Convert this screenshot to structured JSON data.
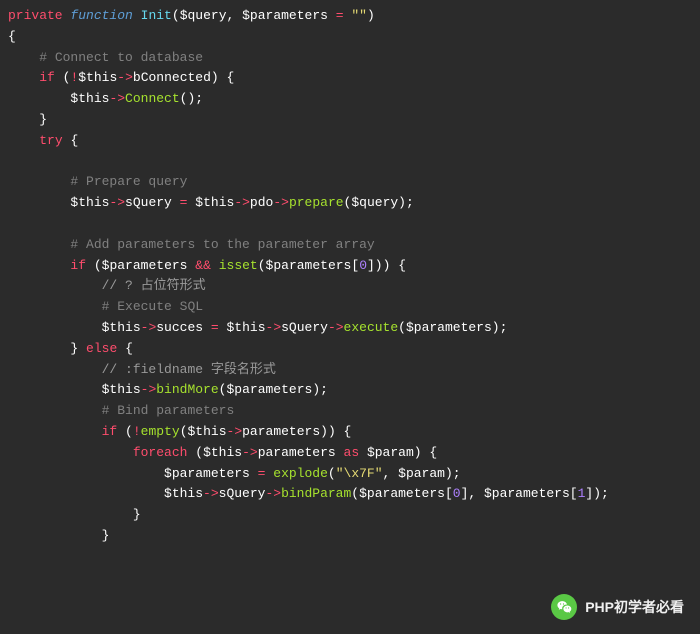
{
  "code": {
    "kw_private": "private",
    "kw_function": "function",
    "fn_init": "Init",
    "v_query": "$query",
    "v_parameters": "$parameters",
    "v_this": "$this",
    "v_param": "$param",
    "str_empty": "\"\"",
    "c_connect": "# Connect to database",
    "kw_if": "if",
    "p_bConnected": "bConnected",
    "fn_Connect": "Connect",
    "kw_try": "try",
    "c_prepare": "# Prepare query",
    "p_sQuery": "sQuery",
    "p_pdo": "pdo",
    "fn_prepare": "prepare",
    "c_addparams": "# Add parameters to the parameter array",
    "fn_isset": "isset",
    "num0": "0",
    "num1": "1",
    "c_placeholder": "// ? 占位符形式",
    "c_execsql": "# Execute SQL",
    "p_succes": "succes",
    "fn_execute": "execute",
    "kw_else": "else",
    "c_fieldname": "// :fieldname 字段名形式",
    "fn_bindMore": "bindMore",
    "c_bindparams": "# Bind parameters",
    "fn_empty": "empty",
    "p_parameters": "parameters",
    "kw_foreach": "foreach",
    "kw_as": "as",
    "fn_explode": "explode",
    "str_x7f": "\"\\x7F\"",
    "fn_bindParam": "bindParam"
  },
  "watermark": {
    "text": "PHP初学者必看"
  }
}
